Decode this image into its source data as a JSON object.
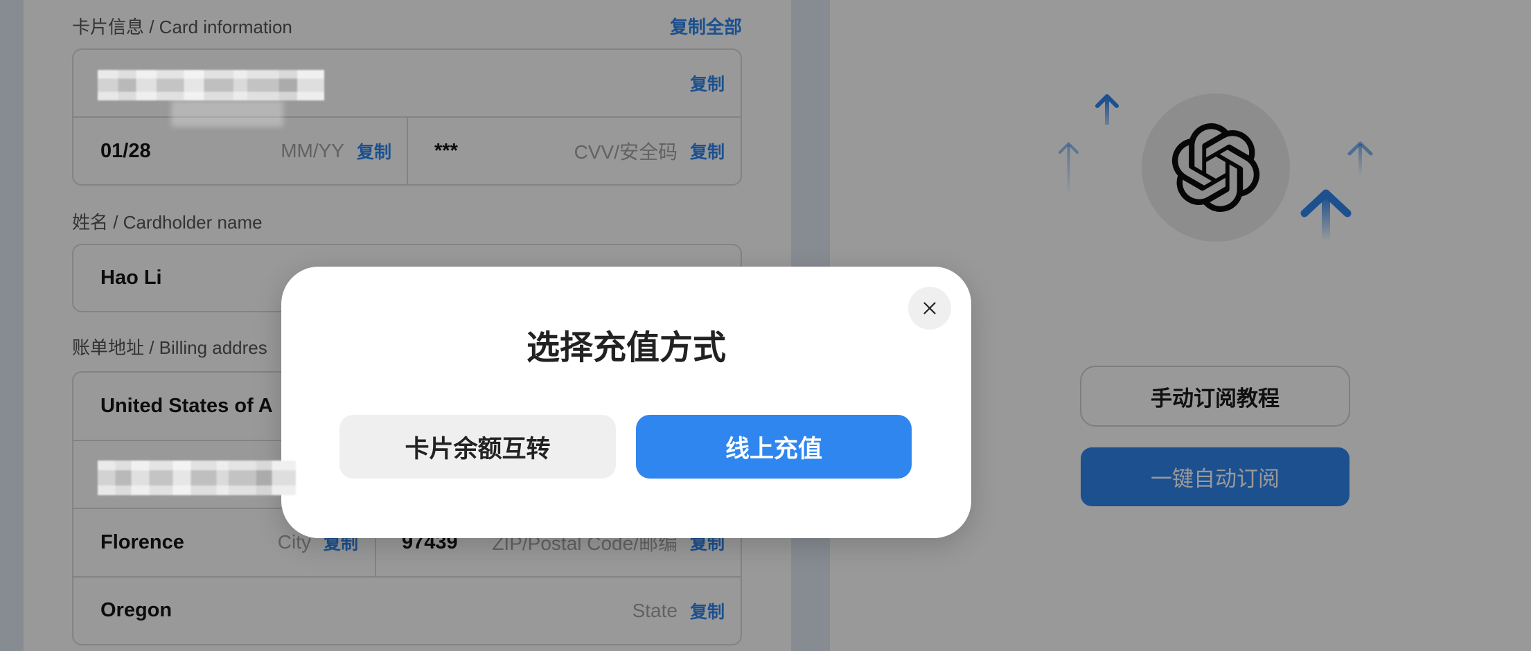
{
  "card_info": {
    "section_label": "卡片信息 / Card information",
    "copy_all_label": "复制全部",
    "number": {
      "copy_label": "复制"
    },
    "expiry": {
      "value": "01/28",
      "hint": "MM/YY",
      "copy_label": "复制"
    },
    "cvv": {
      "value": "***",
      "hint": "CVV/安全码",
      "copy_label": "复制"
    }
  },
  "cardholder": {
    "section_label": "姓名 / Cardholder name",
    "value": "Hao Li"
  },
  "billing": {
    "section_label": "账单地址 / Billing addres",
    "country": "United States of A",
    "city": {
      "value": "Florence",
      "hint": "City",
      "copy_label": "复制"
    },
    "zip": {
      "value": "97439",
      "hint": "ZIP/Postal Code/邮编",
      "copy_label": "复制"
    },
    "state": {
      "value": "Oregon",
      "hint": "State",
      "copy_label": "复制"
    }
  },
  "subscribe": {
    "logo_icon": "openai-logo-icon",
    "decor_icon": "up-arrow-icon",
    "manual_button_label": "手动订阅教程",
    "auto_button_label": "一键自动订阅"
  },
  "modal": {
    "title": "选择充值方式",
    "close_icon": "close-icon",
    "options": [
      {
        "label": "卡片余额互转"
      },
      {
        "label": "线上充值"
      }
    ]
  },
  "colors": {
    "accent": "#2f86ee",
    "page_background": "#e1e9f5",
    "backdrop": "rgba(0,0,0,0.4)",
    "hint_text": "#a3a3a3"
  }
}
